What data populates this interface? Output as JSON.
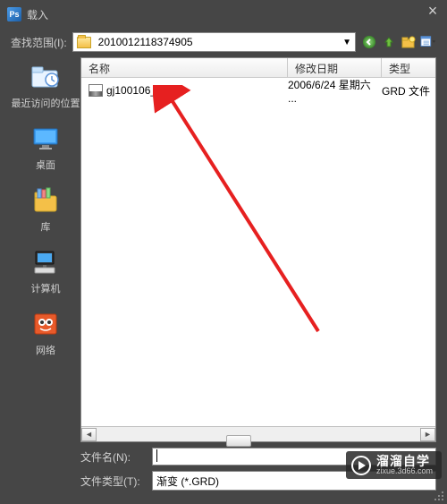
{
  "title": "载入",
  "lookup_label": "查找范围(I):",
  "path_folder": "2010012118374905",
  "columns": {
    "name": "名称",
    "date": "修改日期",
    "type": "类型"
  },
  "sidebar": {
    "recent": "最近访问的位置",
    "desktop": "桌面",
    "library": "库",
    "computer": "计算机",
    "network": "网络"
  },
  "files": [
    {
      "name": "gj100106_3.grd",
      "date": "2006/6/24 星期六 ...",
      "type": "GRD 文件"
    }
  ],
  "filename_label": "文件名(N):",
  "filename_value": "",
  "filetype_label": "文件类型(T):",
  "filetype_value": "渐变 (*.GRD)",
  "watermark_main": "溜溜自学",
  "watermark_sub": "zixue.3d66.com"
}
